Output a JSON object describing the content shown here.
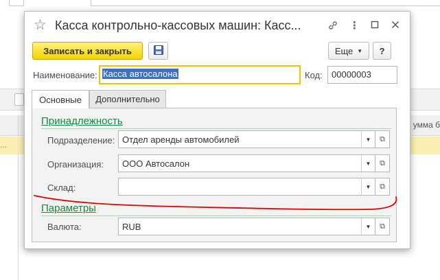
{
  "dialog": {
    "title": "Касса контрольно-кассовых машин: Касс...",
    "buttons": {
      "save_close": "Записать и закрыть",
      "more": "Еще",
      "help": "?"
    },
    "name_label": "Наименование:",
    "name_value": "Касса автосалона",
    "code_label": "Код:",
    "code_value": "00000003",
    "tabs": [
      {
        "label": "Основные",
        "active": true
      },
      {
        "label": "Дополнительно",
        "active": false
      }
    ],
    "groups": {
      "ownership": {
        "title": "Принадлежность",
        "fields": [
          {
            "label": "Подразделение:",
            "value": "Отдел аренды автомобилей"
          },
          {
            "label": "Организация:",
            "value": "ООО Автосалон"
          },
          {
            "label": "Склад:",
            "value": ""
          }
        ]
      },
      "params": {
        "title": "Параметры",
        "fields": [
          {
            "label": "Валюта:",
            "value": "RUB"
          }
        ]
      }
    }
  },
  "background": {
    "column_header": "умма б",
    "row_text": "..."
  },
  "icons": {
    "star": "star-icon",
    "link": "link-icon",
    "more_window": "ellipsis-icon",
    "maximize": "maximize-icon",
    "close": "close-icon",
    "save": "floppy-disk-icon",
    "dropdown": "chevron-down-icon",
    "open": "open-window-icon"
  },
  "colors": {
    "primary_button": "#f2d400",
    "group_title": "#12893a",
    "focus_border": "#f2c200",
    "selection": "#3d6fc0",
    "annotation": "#e00000"
  }
}
